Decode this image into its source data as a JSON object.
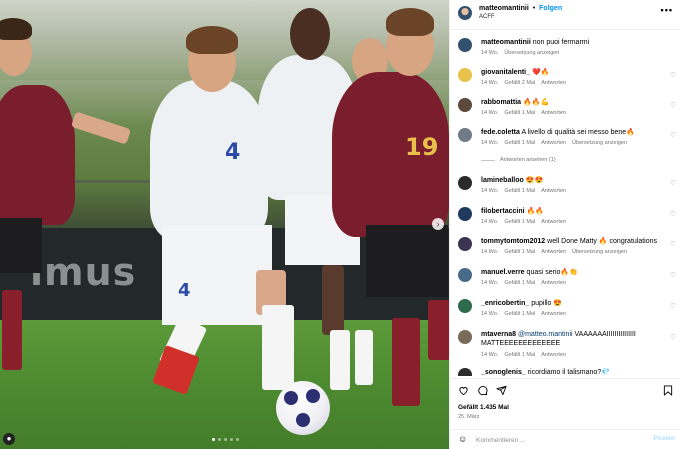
{
  "colors": {
    "accent": "#0095f6",
    "muted": "#737373",
    "mention": "#00376b"
  },
  "photo": {
    "banner_text": "imus",
    "jersey_numbers": [
      "4",
      "19",
      "4"
    ],
    "user_tag_icon": "person-icon",
    "next_icon": "chevron-right-icon",
    "carousel_dots": 5,
    "carousel_active": 0
  },
  "header": {
    "username": "matteomantinii",
    "separator": "•",
    "follow_label": "Folgen",
    "subtitle": "ACFF",
    "more_icon": "more-horizontal-icon"
  },
  "comments": [
    {
      "username": "matteomantinii",
      "text": "non puoi fermarmi",
      "age": "14 Wo.",
      "likes": "",
      "reply": "",
      "translate": "Übersetzung anzeigen",
      "avatar_color": "#33506e",
      "has_heart": false
    },
    {
      "username": "giovanitalenti_",
      "text": "❤️🔥",
      "age": "14 Wo.",
      "likes": "Gefällt 2 Mal",
      "reply": "Antworten",
      "translate": "",
      "avatar_color": "#e8c24a",
      "has_heart": true
    },
    {
      "username": "rabbomattia",
      "text": "🔥🔥💪",
      "age": "14 Wo.",
      "likes": "Gefällt 1 Mal",
      "reply": "Antworten",
      "translate": "",
      "avatar_color": "#5b4a3c",
      "has_heart": true
    },
    {
      "username": "fede.coletta",
      "text": "A livello di qualità sei messo bene🔥",
      "age": "14 Wo.",
      "likes": "Gefällt 1 Mal",
      "reply": "Antworten",
      "translate": "Übersetzung anzeigen",
      "avatar_color": "#6f7b86",
      "has_heart": true
    },
    {
      "username": "lamineballoo",
      "text": "😍😍",
      "age": "14 Wo.",
      "likes": "Gefällt 1 Mal",
      "reply": "Antworten",
      "translate": "",
      "avatar_color": "#2a2a2a",
      "has_heart": true
    },
    {
      "username": "filobertaccini",
      "text": "🔥🔥",
      "age": "14 Wo.",
      "likes": "Gefällt 1 Mal",
      "reply": "Antworten",
      "translate": "",
      "avatar_color": "#1f3a5c",
      "has_heart": true
    },
    {
      "username": "tommytomtom2012",
      "text": "well Done Matty 🔥 congratulations",
      "age": "14 Wo.",
      "likes": "Gefällt 1 Mal",
      "reply": "Antworten",
      "translate": "Übersetzung anzeigen",
      "avatar_color": "#3b3450",
      "has_heart": true
    },
    {
      "username": "manuel.verre",
      "text": "quasi serio🔥👏",
      "age": "14 Wo.",
      "likes": "Gefällt 1 Mal",
      "reply": "Antworten",
      "translate": "",
      "avatar_color": "#4a6a8a",
      "has_heart": true
    },
    {
      "username": "_enricobertin_",
      "text": "pupillo 😍",
      "age": "14 Wo.",
      "likes": "Gefällt 1 Mal",
      "reply": "Antworten",
      "translate": "",
      "avatar_color": "#2e6b4c",
      "has_heart": true
    },
    {
      "username": "mtaverna8",
      "mention": "@matteo.mantinii",
      "text": "VAAAAAAIIIIIIIIIIIIIII MATTEEEEEEEEEEEEE",
      "age": "14 Wo.",
      "likes": "Gefällt 1 Mal",
      "reply": "Antworten",
      "translate": "",
      "avatar_color": "#7a6a5a",
      "has_heart": true
    },
    {
      "username": "_sonoglenis_",
      "text": "ricordiamo il talismano?💎",
      "age": "",
      "likes": "",
      "reply": "",
      "translate": "",
      "avatar_color": "#2b2b2b",
      "has_heart": false
    }
  ],
  "view_replies": "Antworten ansehen (1)",
  "actions": {
    "like_icon": "heart-icon",
    "comment_icon": "comment-icon",
    "share_icon": "send-icon",
    "save_icon": "bookmark-icon",
    "likes_text": "Gefällt 1.435 Mal",
    "date": "25. März"
  },
  "composer": {
    "emoji_icon": "emoji-icon",
    "placeholder": "Kommentieren ...",
    "post_label": "Posten"
  }
}
